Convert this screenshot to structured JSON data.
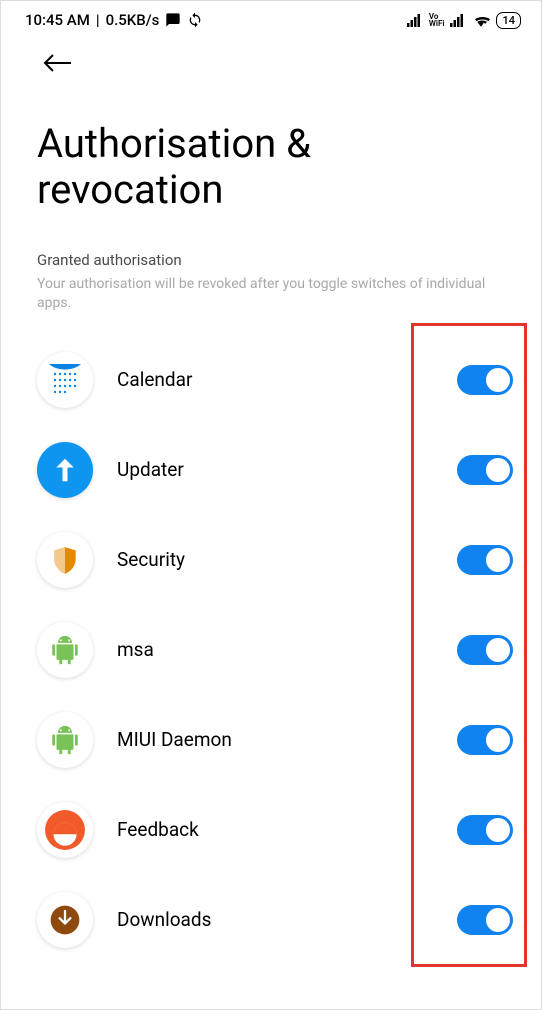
{
  "statusbar": {
    "time": "10:45 AM",
    "speed": "0.5KB/s",
    "battery": "14",
    "vowifi_line1": "Vo",
    "vowifi_line2": "WiFi"
  },
  "page": {
    "title": "Authorisation & revocation"
  },
  "section": {
    "title": "Granted authorisation",
    "description": "Your authorisation will be revoked after you toggle switches of individual apps."
  },
  "apps": [
    {
      "name": "Calendar",
      "icon": "calendar",
      "enabled": true
    },
    {
      "name": "Updater",
      "icon": "updater",
      "enabled": true
    },
    {
      "name": "Security",
      "icon": "security",
      "enabled": true
    },
    {
      "name": "msa",
      "icon": "android",
      "enabled": true
    },
    {
      "name": "MIUI Daemon",
      "icon": "android",
      "enabled": true
    },
    {
      "name": "Feedback",
      "icon": "feedback",
      "enabled": true
    },
    {
      "name": "Downloads",
      "icon": "downloads",
      "enabled": true
    }
  ]
}
